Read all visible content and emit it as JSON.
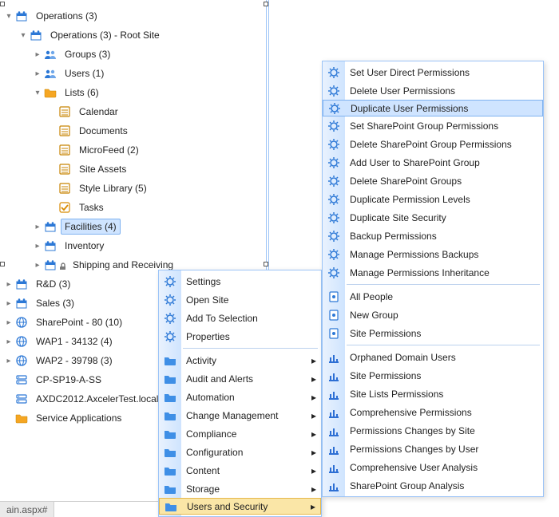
{
  "tree": {
    "root": {
      "label": "Operations (3)"
    },
    "rootSite": {
      "label": "Operations (3) - Root Site"
    },
    "groups": {
      "label": "Groups (3)"
    },
    "users": {
      "label": "Users (1)"
    },
    "lists": {
      "label": "Lists (6)"
    },
    "listsChildren": [
      "Calendar",
      "Documents",
      "MicroFeed (2)",
      "Site Assets",
      "Style Library (5)",
      "Tasks"
    ],
    "facilities": {
      "label": "Facilities (4)"
    },
    "inventory": {
      "label": "Inventory"
    },
    "shipping": {
      "label": "Shipping and Receiving"
    },
    "rd": {
      "label": "R&D (3)"
    },
    "sales": {
      "label": "Sales (3)"
    },
    "servers": [
      {
        "label": "SharePoint - 80 (10)",
        "icon": "globe"
      },
      {
        "label": "WAP1 - 34132 (4)",
        "icon": "globe"
      },
      {
        "label": "WAP2 - 39798 (3)",
        "icon": "globe"
      },
      {
        "label": "CP-SP19-A-SS",
        "icon": "server"
      },
      {
        "label": "AXDC2012.AxcelerTest.local",
        "icon": "server"
      },
      {
        "label": "Service Applications",
        "icon": "folder"
      }
    ]
  },
  "statusbar": {
    "text": "ain.aspx#"
  },
  "menu1": {
    "top": [
      {
        "label": "Settings",
        "icon": "gear"
      },
      {
        "label": "Open Site",
        "icon": "gear"
      },
      {
        "label": "Add To Selection",
        "icon": "gear"
      },
      {
        "label": "Properties",
        "icon": "gear"
      }
    ],
    "folders": [
      {
        "label": "Activity"
      },
      {
        "label": "Audit and Alerts"
      },
      {
        "label": "Automation"
      },
      {
        "label": "Change Management"
      },
      {
        "label": "Compliance"
      },
      {
        "label": "Configuration"
      },
      {
        "label": "Content"
      },
      {
        "label": "Storage"
      },
      {
        "label": "Users and Security",
        "selected": true
      }
    ]
  },
  "menu2": {
    "gearItems": [
      {
        "label": "Set User Direct Permissions"
      },
      {
        "label": "Delete User Permissions"
      },
      {
        "label": "Duplicate User Permissions",
        "highlight": true
      },
      {
        "label": "Set SharePoint Group Permissions"
      },
      {
        "label": "Delete SharePoint Group Permissions"
      },
      {
        "label": "Add User to SharePoint Group"
      },
      {
        "label": "Delete SharePoint Groups"
      },
      {
        "label": "Duplicate Permission Levels"
      },
      {
        "label": "Duplicate Site Security"
      },
      {
        "label": "Backup Permissions"
      },
      {
        "label": "Manage Permissions Backups"
      },
      {
        "label": "Manage Permissions Inheritance"
      }
    ],
    "noteItems": [
      {
        "label": "All People"
      },
      {
        "label": "New Group"
      },
      {
        "label": "Site Permissions"
      }
    ],
    "chartItems": [
      {
        "label": "Orphaned Domain Users"
      },
      {
        "label": "Site Permissions"
      },
      {
        "label": "Site Lists Permissions"
      },
      {
        "label": "Comprehensive Permissions"
      },
      {
        "label": "Permissions Changes by Site"
      },
      {
        "label": "Permissions Changes by User"
      },
      {
        "label": "Comprehensive User Analysis"
      },
      {
        "label": "SharePoint Group Analysis"
      }
    ]
  }
}
